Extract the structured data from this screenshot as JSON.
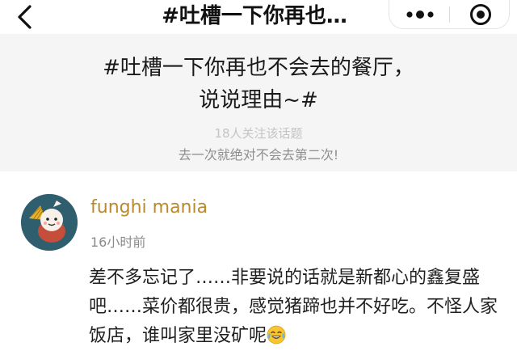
{
  "nav": {
    "title": "#吐槽一下你再也…",
    "back_icon": "chevron-left-icon",
    "more_icon": "more-dots-icon",
    "close_icon": "target-close-icon"
  },
  "topic": {
    "title_line1": "#吐槽一下你再也不会去的餐厅，",
    "title_line2": "说说理由~#",
    "followers": "18人关注该话题",
    "description": "去一次就绝对不会去第二次!"
  },
  "comment": {
    "username": "funghi mania",
    "time": "16小时前",
    "text": "差不多忘记了……非要说的话就是新都心的鑫复盛吧……菜价都很贵，感觉猪蹄也并不好吃。不怪人家饭店，谁叫家里没矿呢",
    "emoji": "tears-of-joy-emoji"
  },
  "colors": {
    "username": "#b98a2e",
    "avatar_bg": "#2f5e6e",
    "topic_bg": "#f5f5f5"
  }
}
